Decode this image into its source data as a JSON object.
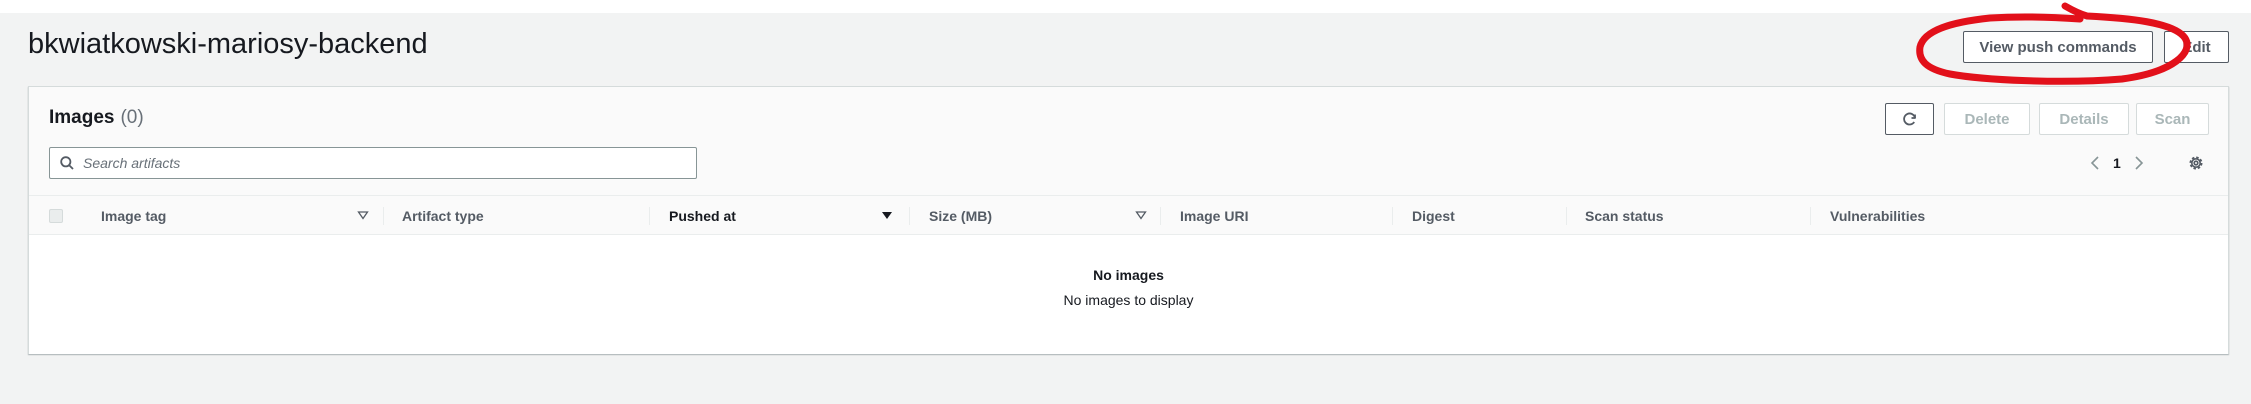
{
  "header": {
    "title": "bkwiatkowski-mariosy-backend",
    "push_commands_label": "View push commands",
    "edit_label": "Edit"
  },
  "images_panel": {
    "heading": "Images",
    "count": "(0)",
    "actions": {
      "delete": "Delete",
      "details": "Details",
      "scan": "Scan"
    },
    "search": {
      "placeholder": "Search artifacts",
      "value": ""
    },
    "pagination": {
      "current_page": "1"
    },
    "table": {
      "columns": [
        "Image tag",
        "Artifact type",
        "Pushed at",
        "Size (MB)",
        "Image URI",
        "Digest",
        "Scan status",
        "Vulnerabilities"
      ],
      "sorted_column": "Pushed at",
      "rows": []
    },
    "empty_state": {
      "title": "No images",
      "message": "No images to display"
    }
  },
  "colors": {
    "page_background": "#f2f3f3",
    "annotation": "#e2101a",
    "header_text": "#545b64",
    "disabled_text": "#aab7b8"
  },
  "icons": [
    "refresh-icon",
    "search-icon",
    "chevron-left-icon",
    "chevron-right-icon",
    "settings-gear-icon",
    "sort-down-icon",
    "sort-both-icon"
  ]
}
